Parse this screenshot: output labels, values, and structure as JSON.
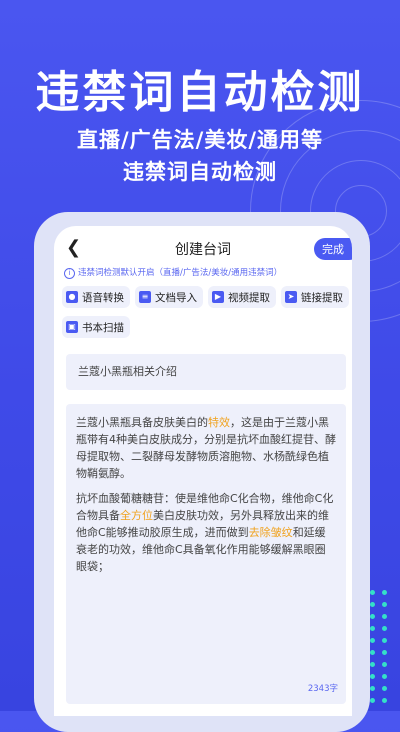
{
  "hero": {
    "title": "违禁词自动检测",
    "subtitle_line1": "直播/广告法/美妆/通用等",
    "subtitle_line2": "违禁词自动检测"
  },
  "screen": {
    "header_title": "创建台词",
    "done_label": "完成",
    "notice": "违禁词检测默认开启（直播/广告法/美妆/通用违禁词）",
    "tools": [
      {
        "label": "语音转换",
        "icon": "microphone-icon"
      },
      {
        "label": "文档导入",
        "icon": "document-icon"
      },
      {
        "label": "视频提取",
        "icon": "video-icon"
      },
      {
        "label": "链接提取",
        "icon": "send-icon"
      },
      {
        "label": "书本扫描",
        "icon": "scan-icon"
      }
    ],
    "script_title": "兰蔻小黑瓶相关介绍",
    "p1_a": "兰蔻小黑瓶具备皮肤美白的",
    "p1_hl": "特效",
    "p1_b": "，这是由于兰蔻小黑瓶带有4种美白皮肤成分，分别是抗坏血酸红提苷、酵母提取物、二裂酵母发酵物质溶胞物、水杨酰绿色植物鞘氨醇。",
    "p2_a": "抗坏血酸葡糖糖苷：使是维他命C化合物，维他命C化合物具备",
    "p2_hl1": "全方位",
    "p2_b": "美白皮肤功效，另外具释放出来的维他命C能够推动胶原生成，进而做到",
    "p2_hl2": "去除皱纹",
    "p2_c": "和延缓衰老的功效，维他命C具备氧化作用能够缓解黑眼圈眼袋；",
    "char_count": "2343字"
  },
  "colors": {
    "background": "#4047e6",
    "accent": "#4a5af2",
    "highlight": "#f0a21e",
    "dots": "#34e0c8"
  }
}
